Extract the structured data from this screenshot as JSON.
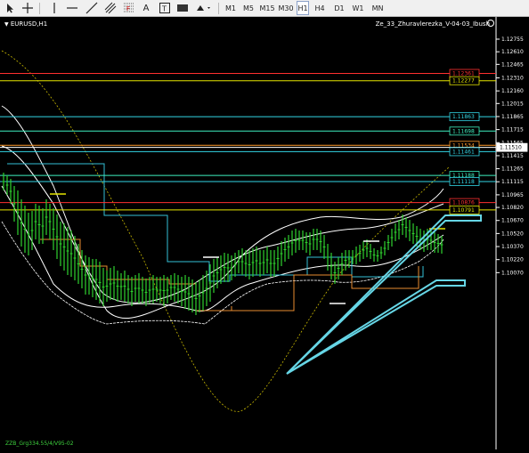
{
  "toolbar": {
    "icons": [
      "cursor-icon",
      "crosshair-icon",
      "vertical-line-icon",
      "horizontal-line-icon",
      "trendline-icon",
      "equidistant-channel-icon",
      "fibonacci-icon",
      "text-icon",
      "text-label-icon",
      "rectangle-icon",
      "shapes-dropdown-icon"
    ],
    "text_tool_label": "A",
    "timeframes": [
      "M1",
      "M5",
      "M15",
      "M30",
      "H1",
      "H4",
      "D1",
      "W1",
      "MN"
    ],
    "active_timeframe": "H1"
  },
  "chart": {
    "symbol": "EURUSD,H1",
    "indicator_label": "Ze_33_Zhuravlerezka_V-04-03_Ibush",
    "footer_label": "ZZB_Grg334.55/4/V95-02",
    "background": "#000000",
    "price_scale": [
      "1.12755",
      "1.12610",
      "1.12465",
      "1.12310",
      "1.12160",
      "1.12015",
      "1.11865",
      "1.11715",
      "1.11565",
      "1.11415",
      "1.11265",
      "1.11115",
      "1.10965",
      "1.10820",
      "1.10670",
      "1.10520",
      "1.10370",
      "1.10220",
      "1.10070"
    ],
    "levels": [
      {
        "name": "level-1-12361",
        "price": "1.12361",
        "color": "#ff3030"
      },
      {
        "name": "level-1-12277",
        "price": "1.12277",
        "color": "#e6e600"
      },
      {
        "name": "level-1-11863",
        "price": "1.11863",
        "color": "#33d6e6"
      },
      {
        "name": "level-1-11698",
        "price": "1.11698",
        "color": "#3ef0c0"
      },
      {
        "name": "level-1-11534",
        "price": "1.11534",
        "color": "#ff9a2a"
      },
      {
        "name": "level-1-11510",
        "price": "1.11510",
        "color": "#ffffff"
      },
      {
        "name": "level-1-11461",
        "price": "1.11461",
        "color": "#33d6e6"
      },
      {
        "name": "level-1-11188",
        "price": "1.11188",
        "color": "#3ef0c0"
      },
      {
        "name": "level-1-11118",
        "price": "1.11118",
        "color": "#33d6e6"
      },
      {
        "name": "level-1-10876",
        "price": "1.10876",
        "color": "#ff3030"
      },
      {
        "name": "level-1-10791",
        "price": "1.10791",
        "color": "#e6e600"
      }
    ]
  }
}
